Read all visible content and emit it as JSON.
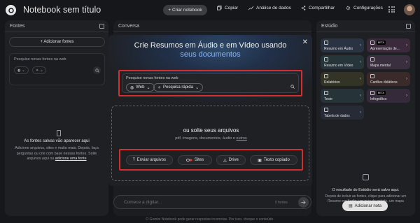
{
  "header": {
    "title": "Notebook sem título",
    "create_label": "+ Criar notebook",
    "copy_label": "Copiar",
    "analytics_label": "Análise de dados",
    "share_label": "Compartilhar",
    "settings_label": "Configurações"
  },
  "sources": {
    "title": "Fontes",
    "add_label": "+ Adicionar fontes",
    "search_placeholder": "Pesquise novas fontes na web",
    "empty_title": "As fontes salvas vão aparecer aqui",
    "empty_text": "Adicione arquivos, sites e muito mais. Depois, faça perguntas ou crie com base nessas fontes. Solte arquivos aqui ou",
    "empty_link": "adicione uma fonte"
  },
  "chat": {
    "title": "Conversa",
    "input_placeholder": "Comece a digitar...",
    "source_count": "0 fontes"
  },
  "modal": {
    "heading": "Crie Resumos em Áudio e em Vídeo usando",
    "heading_highlight": "seus documentos",
    "search_placeholder": "Pesquise novas fontes na web",
    "chip_web": "Web",
    "chip_mode": "Pesquisa rápida",
    "drop_title": "ou solte seus arquivos",
    "drop_sub": "pdf, imagens, documentos, áudio e",
    "drop_sub_link": "outros",
    "buttons": {
      "upload": "Enviar arquivos",
      "sites": "Sites",
      "drive": "Drive",
      "paste": "Texto copiado"
    }
  },
  "studio": {
    "title": "Estúdio",
    "cards": [
      {
        "label": "Resumo em Áudio",
        "color": "#2a3342"
      },
      {
        "label": "Apresentação de...",
        "color": "#3a2a3c",
        "beta": "BETA"
      },
      {
        "label": "Resumo em Vídeo",
        "color": "#26353a"
      },
      {
        "label": "Mapa mental",
        "color": "#3a2f3f"
      },
      {
        "label": "Relatórios",
        "color": "#343426"
      },
      {
        "label": "Cartões didáticos",
        "color": "#3a2b2a"
      },
      {
        "label": "Teste",
        "color": "#263338"
      },
      {
        "label": "Infográfico",
        "color": "#352a3a",
        "beta": "BETA"
      },
      {
        "label": "Tabela de dados",
        "color": "#262b35"
      }
    ],
    "empty_title": "O resultado do Estúdio será salvo aqui.",
    "empty_text": "Depois de incluir as fontes, clique para adicionar um Resumo em Áudio, um guia de estudo, um mapa mental e muito mais!",
    "add_note_label": "Adicionar nota"
  },
  "footer": "O Gemini Notebook pode gerar respostas incorretas. Por isso, cheque o conteúdo."
}
